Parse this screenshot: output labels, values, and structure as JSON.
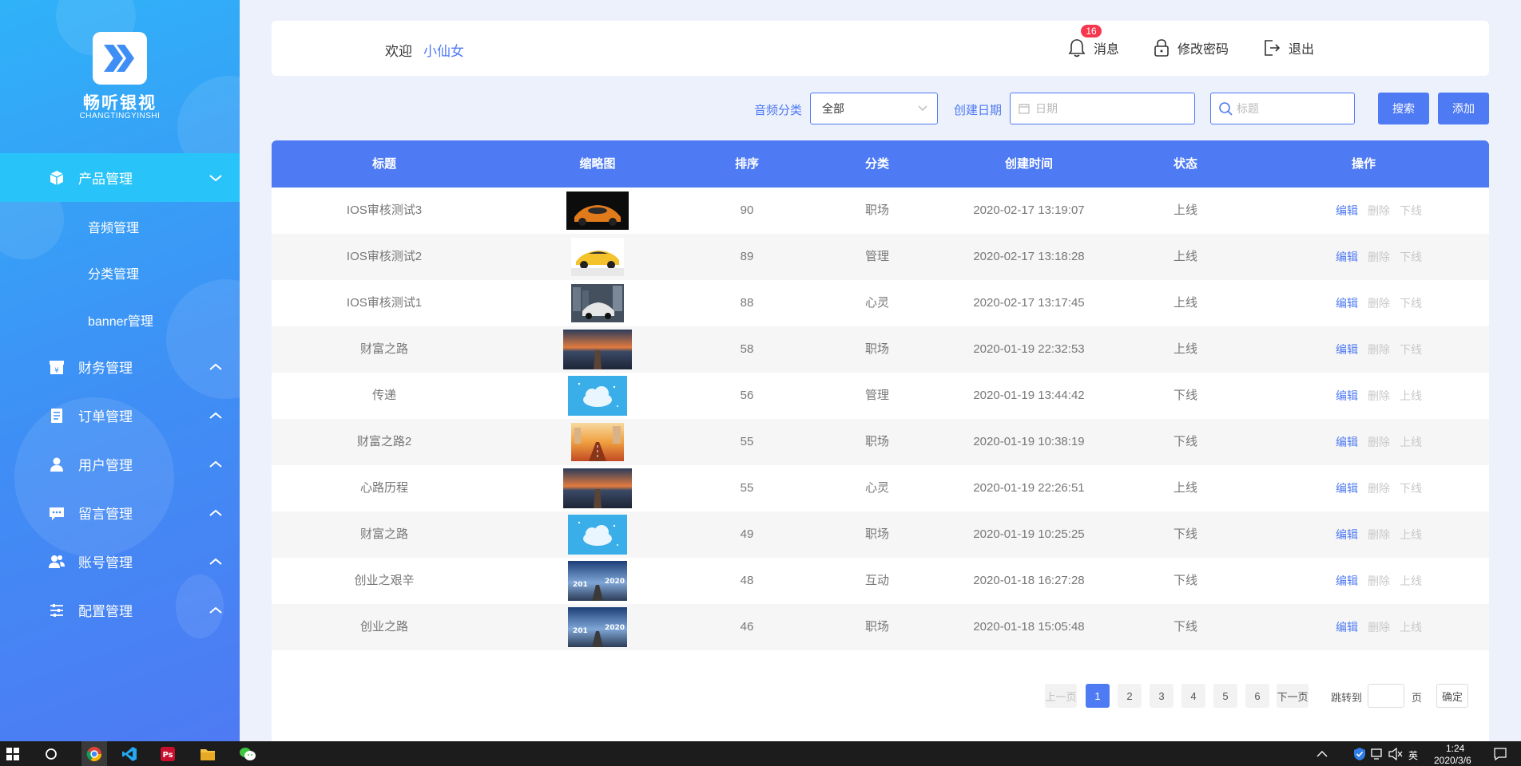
{
  "brand": {
    "name": "畅听银视",
    "subtitle": "CHANGTINGYINSHI"
  },
  "sidebar": {
    "menus": [
      {
        "label": "产品管理",
        "icon": "box-icon",
        "active": true,
        "expanded": true,
        "children": [
          "音频管理",
          "分类管理",
          "banner管理"
        ]
      },
      {
        "label": "财务管理",
        "icon": "finance-icon"
      },
      {
        "label": "订单管理",
        "icon": "order-icon"
      },
      {
        "label": "用户管理",
        "icon": "user-icon"
      },
      {
        "label": "留言管理",
        "icon": "message-icon"
      },
      {
        "label": "账号管理",
        "icon": "accounts-icon"
      },
      {
        "label": "配置管理",
        "icon": "settings-sliders-icon"
      }
    ]
  },
  "header": {
    "welcome": "欢迎",
    "username": "小仙女",
    "badge_count": "16",
    "messages_label": "消息",
    "change_password_label": "修改密码",
    "logout_label": "退出"
  },
  "filters": {
    "category_label": "音频分类",
    "category_value": "全部",
    "date_label": "创建日期",
    "date_placeholder": "日期",
    "title_placeholder": "标题",
    "search_btn": "搜索",
    "add_btn": "添加"
  },
  "table": {
    "headers": [
      "标题",
      "缩略图",
      "排序",
      "分类",
      "创建时间",
      "状态",
      "操作"
    ],
    "rows": [
      {
        "title": "IOS审核测试3",
        "thumb": "car-black",
        "sort": "90",
        "category": "职场",
        "created": "2020-02-17 13:19:07",
        "status": "上线",
        "toggle": "下线"
      },
      {
        "title": "IOS审核测试2",
        "thumb": "car-yellow",
        "sort": "89",
        "category": "管理",
        "created": "2020-02-17 13:18:28",
        "status": "上线",
        "toggle": "下线"
      },
      {
        "title": "IOS审核测试1",
        "thumb": "car-city",
        "sort": "88",
        "category": "心灵",
        "created": "2020-02-17 13:17:45",
        "status": "上线",
        "toggle": "下线"
      },
      {
        "title": "财富之路",
        "thumb": "sunset-pier",
        "sort": "58",
        "category": "职场",
        "created": "2020-01-19 22:32:53",
        "status": "上线",
        "toggle": "下线"
      },
      {
        "title": "传递",
        "thumb": "cloud-blue",
        "sort": "56",
        "category": "管理",
        "created": "2020-01-19 13:44:42",
        "status": "下线",
        "toggle": "上线"
      },
      {
        "title": "财富之路2",
        "thumb": "sunrise-road",
        "sort": "55",
        "category": "职场",
        "created": "2020-01-19 10:38:19",
        "status": "下线",
        "toggle": "上线"
      },
      {
        "title": "心路历程",
        "thumb": "sunset-pier",
        "sort": "55",
        "category": "心灵",
        "created": "2020-01-19 22:26:51",
        "status": "上线",
        "toggle": "下线"
      },
      {
        "title": "财富之路",
        "thumb": "cloud-blue",
        "sort": "49",
        "category": "职场",
        "created": "2020-01-19 10:25:25",
        "status": "下线",
        "toggle": "上线"
      },
      {
        "title": "创业之艰辛",
        "thumb": "road-2020",
        "sort": "48",
        "category": "互动",
        "created": "2020-01-18 16:27:28",
        "status": "下线",
        "toggle": "上线"
      },
      {
        "title": "创业之路",
        "thumb": "road-2020",
        "sort": "46",
        "category": "职场",
        "created": "2020-01-18 15:05:48",
        "status": "下线",
        "toggle": "上线"
      }
    ],
    "edit_label": "编辑",
    "delete_label": "删除"
  },
  "pagination": {
    "prev": "上一页",
    "pages": [
      "1",
      "2",
      "3",
      "4",
      "5",
      "6"
    ],
    "current": "1",
    "next": "下一页",
    "goto_label": "跳转到",
    "page_unit": "页",
    "confirm": "确定"
  },
  "taskbar": {
    "time": "1:24",
    "date": "2020/3/6",
    "ime": "英"
  },
  "colors": {
    "accent": "#4e7af3",
    "sidebar_active": "#28c4f9"
  }
}
